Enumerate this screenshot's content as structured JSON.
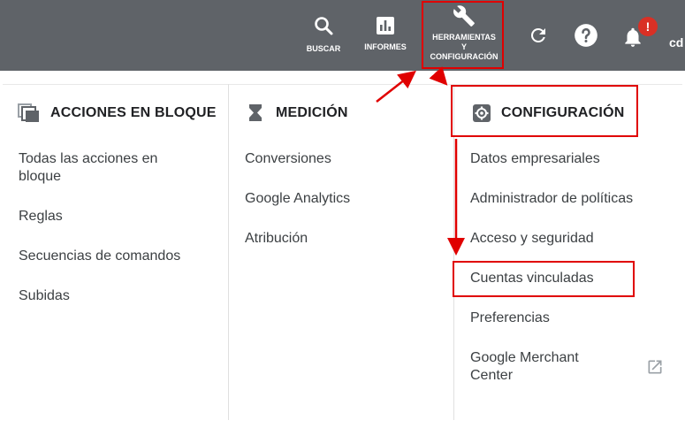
{
  "topbar": {
    "search_label": "BUSCAR",
    "reports_label": "INFORMES",
    "tools_label_1": "HERRAMIENTAS",
    "tools_label_2": "Y",
    "tools_label_3": "CONFIGURACIÓN",
    "notification_badge": "!",
    "user_text": "cd"
  },
  "columns": {
    "bulk": {
      "title": "ACCIONES EN BLOQUE",
      "icon": "copy-stack-icon",
      "items": [
        "Todas las acciones en bloque",
        "Reglas",
        "Secuencias de comandos",
        "Subidas"
      ]
    },
    "measurement": {
      "title": "MEDICIÓN",
      "icon": "hourglass-icon",
      "items": [
        "Conversiones",
        "Google Analytics",
        "Atribución"
      ]
    },
    "setup": {
      "title": "CONFIGURACIÓN",
      "icon": "gear-icon",
      "items": [
        "Datos empresariales",
        "Administrador de políticas",
        "Acceso y seguridad",
        "Cuentas vinculadas",
        "Preferencias",
        "Google Merchant Center"
      ]
    }
  },
  "colors": {
    "topbar_bg": "#5f6368",
    "annotation_red": "#e00000",
    "badge_red": "#d93025"
  }
}
